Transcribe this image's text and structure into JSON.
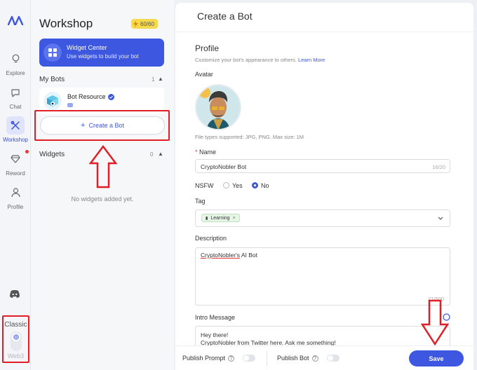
{
  "nav": {
    "items": [
      {
        "label": "Explore",
        "icon": "bulb-icon"
      },
      {
        "label": "Chat",
        "icon": "chat-icon"
      },
      {
        "label": "Workshop",
        "icon": "tools-icon"
      },
      {
        "label": "Reword",
        "icon": "gem-icon"
      },
      {
        "label": "Profile",
        "icon": "person-icon"
      }
    ],
    "mode_classic": "Classic",
    "mode_web3": "Web3"
  },
  "workshop": {
    "title": "Workshop",
    "credits": "60/60",
    "widget_center": {
      "title": "Widget Center",
      "subtitle": "Use widgets to build your bot"
    },
    "my_bots": {
      "label": "My Bots",
      "count": "1"
    },
    "bot": {
      "name": "Bot Resource"
    },
    "create_label": "Create a Bot",
    "widgets": {
      "label": "Widgets",
      "count": "0"
    },
    "no_widgets": "No widgets added yet."
  },
  "form": {
    "title": "Create a Bot",
    "profile_title": "Profile",
    "profile_hint": "Customize your bot's appearance to others.",
    "learn_more": "Learn More",
    "avatar_label": "Avatar",
    "avatar_hint": "File types supported: JPG, PNG. Max size: 1M",
    "name_label": "Name",
    "name_value": "CryptoNobler Bot",
    "name_counter": "16/20",
    "nsfw_label": "NSFW",
    "nsfw_yes": "Yes",
    "nsfw_no": "No",
    "tag_label": "Tag",
    "tag_value": "Learning",
    "description_label": "Description",
    "description_value_link": "CryptoNobler's",
    "description_value_rest": " AI Bot",
    "description_counter": "21/500",
    "intro_label": "Intro Message",
    "intro_line1": "Hey there!",
    "intro_line2": "CryptoNobler from Twitter here. Ask me something!"
  },
  "footer": {
    "publish_prompt": "Publish Prompt",
    "publish_bot": "Publish Bot",
    "save": "Save"
  },
  "colors": {
    "accent": "#3d57e0",
    "highlight": "#e01e26"
  }
}
